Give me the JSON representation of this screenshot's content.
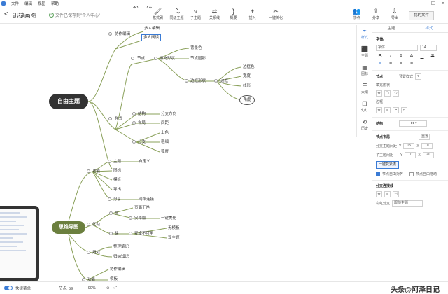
{
  "menu": [
    "文件",
    "编辑",
    "视图",
    "帮助"
  ],
  "window_controls": [
    "—",
    "☐",
    "✕"
  ],
  "header": {
    "back": "<",
    "title": "迅捷画图",
    "save_status": "文件已保存到\"个人中心\""
  },
  "undo_redo": [
    "↶",
    "↷"
  ],
  "toolbar": [
    {
      "icon": "brush-icon",
      "glyph": "🖌",
      "label": "格式刷"
    },
    {
      "icon": "topic-icon",
      "glyph": "⤵",
      "label": "同级主题"
    },
    {
      "icon": "subtopic-icon",
      "glyph": "⤷",
      "label": "子主题"
    },
    {
      "icon": "relation-icon",
      "glyph": "⇄",
      "label": "关系线"
    },
    {
      "icon": "summary-icon",
      "glyph": "}",
      "label": "概要"
    },
    {
      "icon": "insert-icon",
      "glyph": "+",
      "label": "插入"
    },
    {
      "icon": "beautify-icon",
      "glyph": "✂",
      "label": "一键美化"
    }
  ],
  "right_tools": [
    {
      "icon": "collab-icon",
      "glyph": "👥",
      "label": "协作"
    },
    {
      "icon": "share-icon",
      "glyph": "⇪",
      "label": "分享"
    },
    {
      "icon": "export-icon",
      "glyph": "⇩",
      "label": "导出"
    }
  ],
  "my_files": "我的文件",
  "central_topic": "自由主题",
  "main_topic": "思维导图",
  "nodes": {
    "n1": "协作编辑",
    "n2": "多人编辑",
    "n3": "多人阅读",
    "n4": "节点",
    "n5": "填充形状",
    "n6": "背景色",
    "n7": "节点圆影",
    "n8": "边框形状",
    "n9": "边框",
    "n10": "边框色",
    "n11": "宽度",
    "n12": "线形",
    "n13": "角度",
    "n14": "样式",
    "n15": "结构",
    "n16": "分支方向",
    "n17": "布局",
    "n18": "间距",
    "n19": "分支",
    "n20": "上色",
    "n21": "粗细",
    "n22": "弧度",
    "n23": "功能",
    "n24": "主题",
    "n25": "自定义",
    "n26": "图标",
    "n27": "模板",
    "n28": "导出",
    "n29": "分享",
    "n30": "网络连接",
    "n31": "优缺",
    "n32": "优",
    "n33": "页面干净",
    "n34": "安卓版",
    "n35": "一键美化",
    "n36": "缺",
    "n37": "安卓不可用",
    "n38": "无模板",
    "n39": "双主题",
    "n40": "用处",
    "n41": "整理笔记",
    "n42": "归纳知识",
    "n43": "功能",
    "n44": "协作编辑",
    "n45": "模板"
  },
  "side_icons": [
    {
      "icon": "style-icon",
      "glyph": "✒",
      "label": "样式"
    },
    {
      "icon": "theme-icon",
      "glyph": "⬛",
      "label": "主题"
    },
    {
      "icon": "chart-icon",
      "glyph": "▦",
      "label": "图标"
    },
    {
      "icon": "outline-icon",
      "glyph": "☰",
      "label": "大纲"
    },
    {
      "icon": "layer-icon",
      "glyph": "❐",
      "label": "幻灯"
    },
    {
      "icon": "history-icon",
      "glyph": "⟲",
      "label": "历史"
    }
  ],
  "panel": {
    "tabs": [
      "主题",
      "样式"
    ],
    "font_title": "字体",
    "font_value": "字体",
    "font_size": "14",
    "format_icons": [
      "B",
      "I",
      "A",
      "A",
      "U",
      "S"
    ],
    "align_icons": [
      "≡",
      "≡",
      "≡",
      "≡"
    ],
    "node_title": "节点",
    "preset": "预置样式",
    "fill_shape": "填充形状",
    "border_title": "边框",
    "structure_title": "结构",
    "node_layout": "节点布局",
    "reset": "重置",
    "branch_spacing_label": "分支主题间距",
    "branch_y": "15",
    "branch_x": "10",
    "sub_spacing_label": "子主题间距",
    "sub_y": "7",
    "sub_x": "20",
    "one_key": "一键变紧凑",
    "opt1": "节点自由对齐",
    "opt2": "节点自由拖动",
    "branch_link": "分支连接线",
    "color_branch": "彩虹分支",
    "color_value": "跟随主题"
  },
  "status": {
    "quick": "快捷菜单",
    "nodes": "节点: 59",
    "zoom": "90%",
    "minus": "—",
    "plus": "+"
  },
  "watermark": "头条@阿泽日记"
}
